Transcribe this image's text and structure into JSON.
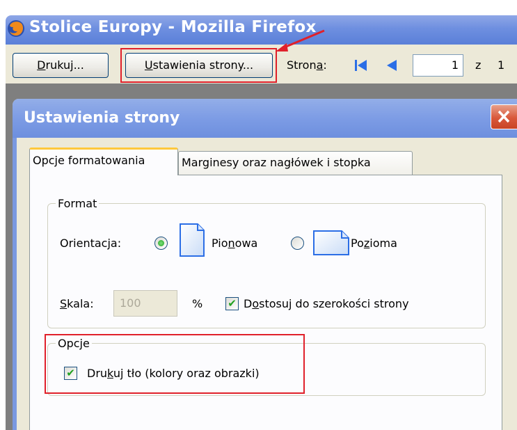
{
  "window": {
    "title": "Stolice Europy - Mozilla Firefox"
  },
  "toolbar": {
    "print_label_ul": "D",
    "print_label_rest": "rukuj...",
    "setup_label_ul": "U",
    "setup_label_rest": "stawienia strony...",
    "page_label_pre": "Stron",
    "page_label_ul": "a",
    "page_label_post": ":",
    "page_value": "1",
    "of_label": "z",
    "total_pages": "1"
  },
  "dialog": {
    "title": "Ustawienia strony",
    "close_icon": "close-icon",
    "tabs": [
      {
        "label": "Opcje formatowania",
        "active": true
      },
      {
        "label": "Marginesy oraz nagłówek i stopka",
        "active": false
      }
    ],
    "format": {
      "legend": "Format",
      "orientation_label": "Orientacja:",
      "portrait_pre": "Pio",
      "portrait_ul": "n",
      "portrait_post": "owa",
      "landscape_pre": "Po",
      "landscape_ul": "z",
      "landscape_post": "ioma",
      "orientation_selected": "portrait",
      "scale_label_ul": "S",
      "scale_label_rest": "kala:",
      "scale_value": "100",
      "percent": "%",
      "shrink_pre": "D",
      "shrink_ul": "o",
      "shrink_post": "stosuj do szerokości strony",
      "shrink_checked": true
    },
    "options": {
      "legend": "Opcje",
      "bg_pre": "Dru",
      "bg_ul": "k",
      "bg_post": "uj tło (kolory oraz obrazki)",
      "bg_checked": true
    }
  },
  "colors": {
    "highlight": "#e0202a",
    "titlebar": "#6e8fe0",
    "dialog_bg": "#ece9d8"
  }
}
